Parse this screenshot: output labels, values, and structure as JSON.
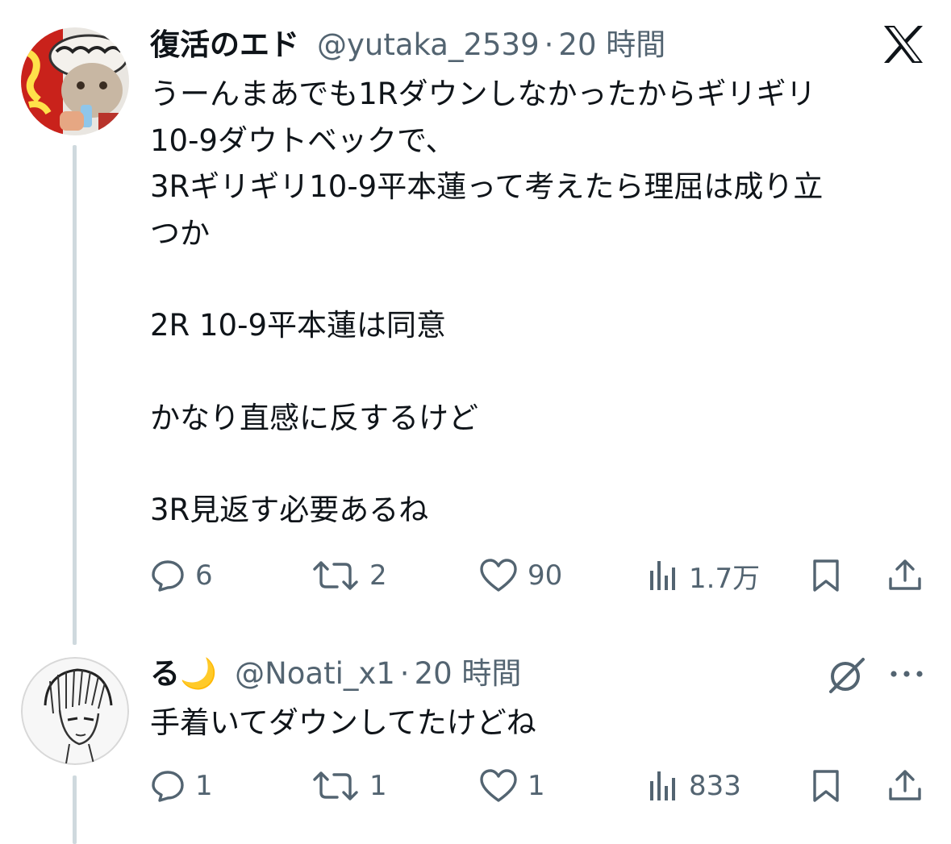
{
  "tweet1": {
    "display_name": "復活のエド",
    "handle": "@yutaka_2539",
    "separator": "·",
    "time": "20 時間",
    "lines": [
      "うーんまあでも1Rダウンしなかったからギリギリ",
      "10-9ダウトベックで、",
      "3Rギリギリ10-9平本蓮って考えたら理屈は成り立",
      "つか",
      "",
      "2R 10-9平本蓮は同意",
      "",
      "かなり直感に反するけど",
      "",
      "3R見返す必要あるね"
    ],
    "replies": "6",
    "reposts": "2",
    "likes": "90",
    "views": "1.7万",
    "platform_icon": "x-logo-icon"
  },
  "tweet2": {
    "display_name": "る🌙",
    "handle": "@Noati_x1",
    "separator": "·",
    "time": "20 時間",
    "text": "手着いてダウンしてたけどね",
    "replies": "1",
    "reposts": "1",
    "likes": "1",
    "views": "833",
    "badge_icon": "grok-icon",
    "menu_icon": "more-icon"
  },
  "colors": {
    "text": "#0f1419",
    "secondary": "#536471",
    "thread_line": "#cfd9de"
  }
}
